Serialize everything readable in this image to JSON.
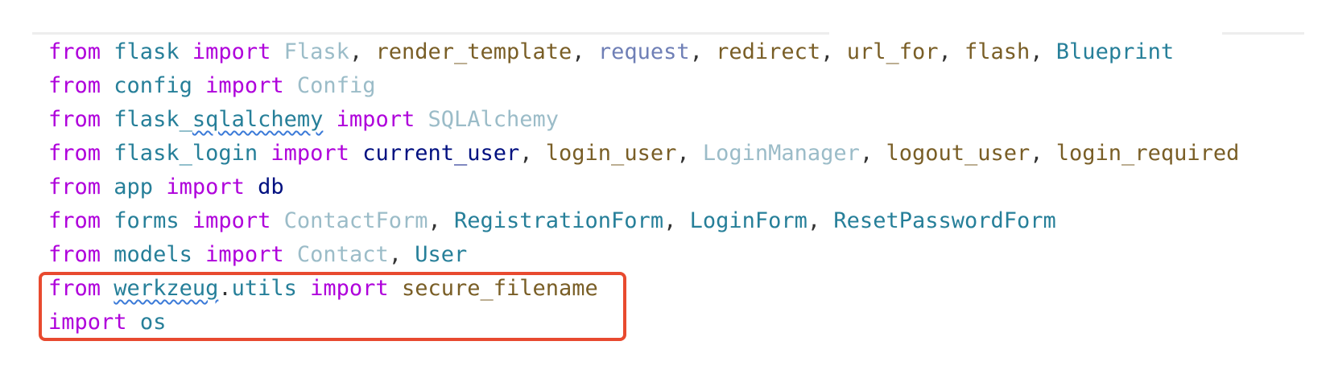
{
  "editor": {
    "lines": [
      [
        {
          "t": "from",
          "c": "kw"
        },
        {
          "t": " ",
          "c": "punc"
        },
        {
          "t": "flask",
          "c": "mod"
        },
        {
          "t": " ",
          "c": "punc"
        },
        {
          "t": "import",
          "c": "kw"
        },
        {
          "t": " ",
          "c": "punc"
        },
        {
          "t": "Flask",
          "c": "cls"
        },
        {
          "t": ", ",
          "c": "punc"
        },
        {
          "t": "render_template",
          "c": "fn"
        },
        {
          "t": ", ",
          "c": "punc"
        },
        {
          "t": "request",
          "c": "fn2"
        },
        {
          "t": ", ",
          "c": "punc"
        },
        {
          "t": "redirect",
          "c": "fn"
        },
        {
          "t": ", ",
          "c": "punc"
        },
        {
          "t": "url_for",
          "c": "fn"
        },
        {
          "t": ", ",
          "c": "punc"
        },
        {
          "t": "flash",
          "c": "fn"
        },
        {
          "t": ", ",
          "c": "punc"
        },
        {
          "t": "Blueprint",
          "c": "cls2"
        }
      ],
      [
        {
          "t": "from",
          "c": "kw"
        },
        {
          "t": " ",
          "c": "punc"
        },
        {
          "t": "config",
          "c": "mod"
        },
        {
          "t": " ",
          "c": "punc"
        },
        {
          "t": "import",
          "c": "kw"
        },
        {
          "t": " ",
          "c": "punc"
        },
        {
          "t": "Config",
          "c": "cls"
        }
      ],
      [
        {
          "t": "from",
          "c": "kw"
        },
        {
          "t": " ",
          "c": "punc"
        },
        {
          "t": "flask_",
          "c": "mod"
        },
        {
          "t": "sqlalchemy",
          "c": "mod",
          "squiggle": true
        },
        {
          "t": " ",
          "c": "punc"
        },
        {
          "t": "import",
          "c": "kw"
        },
        {
          "t": " ",
          "c": "punc"
        },
        {
          "t": "SQLAlchemy",
          "c": "cls"
        }
      ],
      [
        {
          "t": "from",
          "c": "kw"
        },
        {
          "t": " ",
          "c": "punc"
        },
        {
          "t": "flask_login",
          "c": "mod"
        },
        {
          "t": " ",
          "c": "punc"
        },
        {
          "t": "import",
          "c": "kw"
        },
        {
          "t": " ",
          "c": "punc"
        },
        {
          "t": "current_user",
          "c": "var"
        },
        {
          "t": ", ",
          "c": "punc"
        },
        {
          "t": "login_user",
          "c": "fn"
        },
        {
          "t": ", ",
          "c": "punc"
        },
        {
          "t": "LoginManager",
          "c": "cls"
        },
        {
          "t": ", ",
          "c": "punc"
        },
        {
          "t": "logout_user",
          "c": "fn"
        },
        {
          "t": ", ",
          "c": "punc"
        },
        {
          "t": "login_required",
          "c": "fn"
        }
      ],
      [
        {
          "t": "from",
          "c": "kw"
        },
        {
          "t": " ",
          "c": "punc"
        },
        {
          "t": "app",
          "c": "mod"
        },
        {
          "t": " ",
          "c": "punc"
        },
        {
          "t": "import",
          "c": "kw"
        },
        {
          "t": " ",
          "c": "punc"
        },
        {
          "t": "db",
          "c": "var"
        }
      ],
      [
        {
          "t": "from",
          "c": "kw"
        },
        {
          "t": " ",
          "c": "punc"
        },
        {
          "t": "forms",
          "c": "mod"
        },
        {
          "t": " ",
          "c": "punc"
        },
        {
          "t": "import",
          "c": "kw"
        },
        {
          "t": " ",
          "c": "punc"
        },
        {
          "t": "ContactForm",
          "c": "cls"
        },
        {
          "t": ", ",
          "c": "punc"
        },
        {
          "t": "RegistrationForm",
          "c": "cls2"
        },
        {
          "t": ", ",
          "c": "punc"
        },
        {
          "t": "LoginForm",
          "c": "cls2"
        },
        {
          "t": ", ",
          "c": "punc"
        },
        {
          "t": "ResetPasswordForm",
          "c": "cls2"
        }
      ],
      [
        {
          "t": "from",
          "c": "kw"
        },
        {
          "t": " ",
          "c": "punc"
        },
        {
          "t": "models",
          "c": "mod"
        },
        {
          "t": " ",
          "c": "punc"
        },
        {
          "t": "import",
          "c": "kw"
        },
        {
          "t": " ",
          "c": "punc"
        },
        {
          "t": "Contact",
          "c": "cls"
        },
        {
          "t": ", ",
          "c": "punc"
        },
        {
          "t": "User",
          "c": "cls2"
        }
      ],
      [
        {
          "t": "from",
          "c": "kw"
        },
        {
          "t": " ",
          "c": "punc"
        },
        {
          "t": "werkzeug",
          "c": "mod",
          "squiggle": true
        },
        {
          "t": ".",
          "c": "punc"
        },
        {
          "t": "utils",
          "c": "mod"
        },
        {
          "t": " ",
          "c": "punc"
        },
        {
          "t": "import",
          "c": "kw"
        },
        {
          "t": " ",
          "c": "punc"
        },
        {
          "t": "secure_filename",
          "c": "fn"
        }
      ],
      [
        {
          "t": "import",
          "c": "kw"
        },
        {
          "t": " ",
          "c": "punc"
        },
        {
          "t": "os",
          "c": "mod"
        }
      ]
    ]
  },
  "highlight": {
    "color": "#e84a2f",
    "covers_lines": [
      8,
      9
    ]
  }
}
